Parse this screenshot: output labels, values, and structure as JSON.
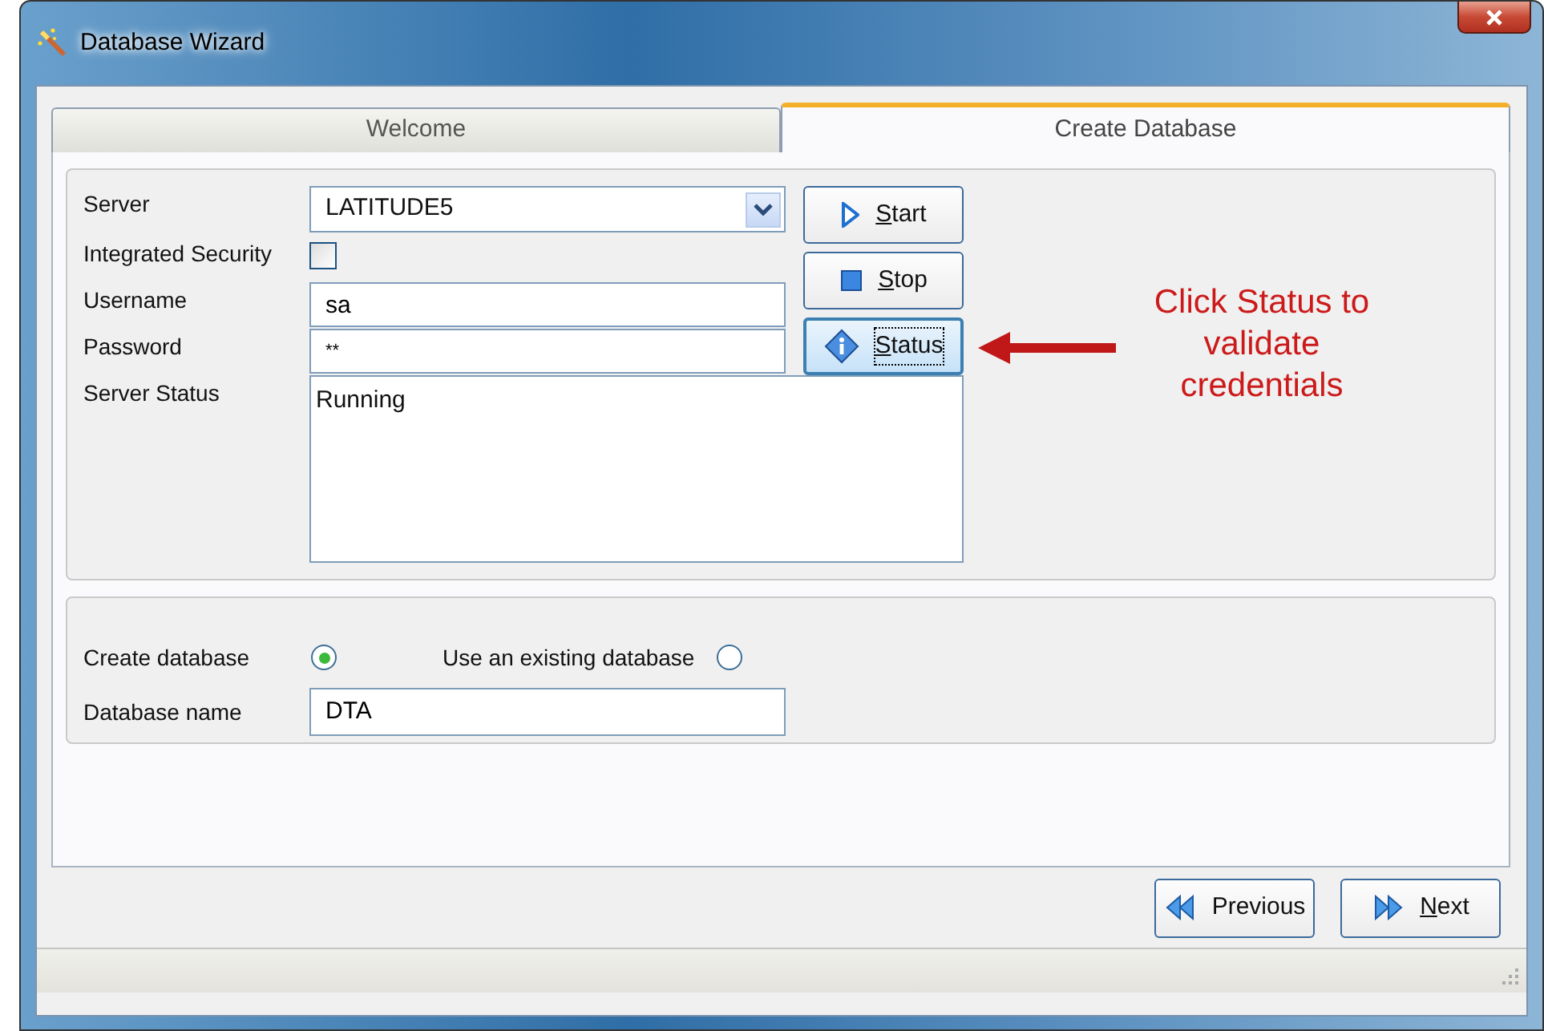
{
  "window": {
    "title": "Database Wizard"
  },
  "tabs": [
    {
      "label": "Welcome",
      "selected": false
    },
    {
      "label": "Create Database",
      "selected": true
    }
  ],
  "server_group": {
    "server": {
      "label": "Server",
      "value": "LATITUDE5"
    },
    "integrated_security": {
      "label": "Integrated Security",
      "checked": false
    },
    "username": {
      "label": "Username",
      "value": "sa"
    },
    "password": {
      "label": "Password",
      "value": "**"
    },
    "server_status": {
      "label": "Server Status",
      "value": "Running"
    },
    "buttons": [
      {
        "kind": "start",
        "label": "Start",
        "mnemonic_underlined": true,
        "focused": false
      },
      {
        "kind": "stop",
        "label": "Stop",
        "mnemonic_underlined": true,
        "focused": false
      },
      {
        "kind": "status",
        "label": "Status",
        "mnemonic_underlined": true,
        "focused": true
      }
    ]
  },
  "annotation": {
    "text": "Click Status to validate credentials"
  },
  "database_group": {
    "options": [
      {
        "label": "Create database",
        "selected": true
      },
      {
        "label": "Use an existing database",
        "selected": false
      }
    ],
    "database_name": {
      "label": "Database name",
      "value": "DTA"
    }
  },
  "nav_buttons": [
    {
      "kind": "previous",
      "label": "Previous",
      "mnemonic_underlined": false
    },
    {
      "kind": "next",
      "label": "Next",
      "mnemonic_underlined": true
    }
  ]
}
